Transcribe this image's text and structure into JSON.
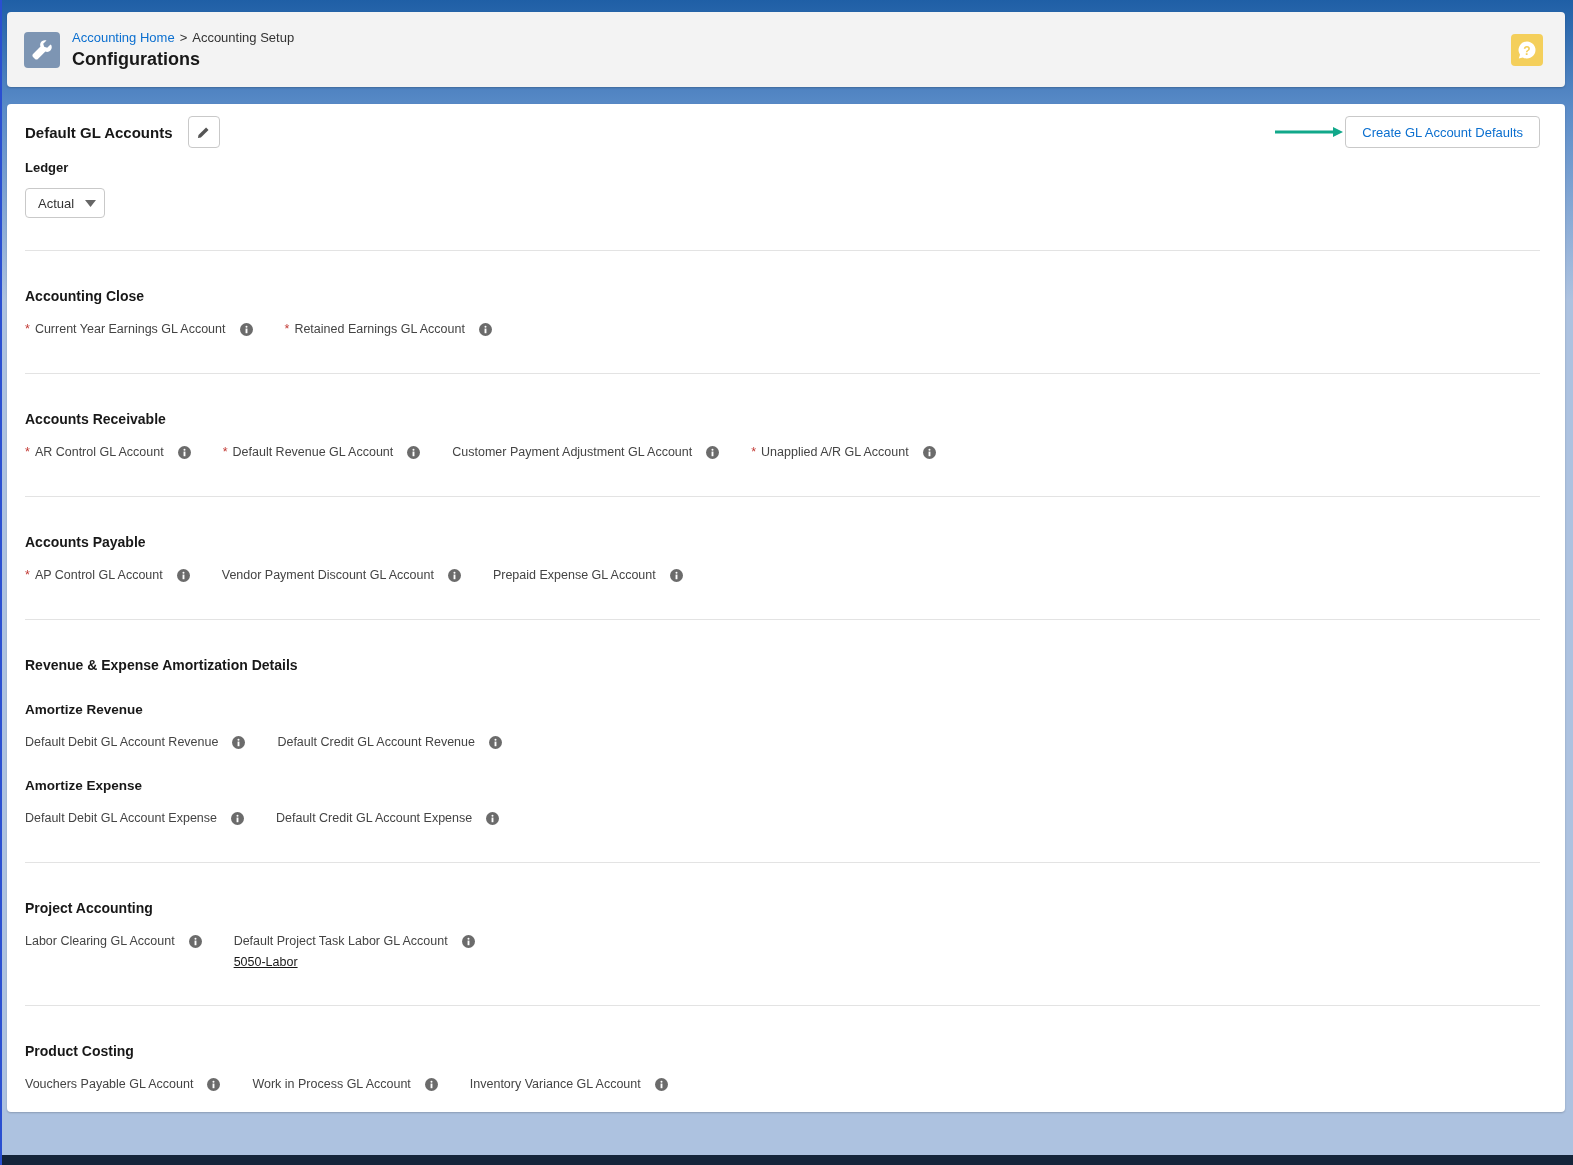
{
  "header": {
    "breadcrumb": [
      {
        "label": "Accounting Home",
        "link": true
      },
      {
        "label": "Accounting Setup",
        "link": false
      }
    ],
    "separator": ">",
    "title": "Configurations",
    "help": "?"
  },
  "required_marker": "*",
  "card": {
    "title": "Default GL Accounts",
    "action_button": "Create GL Account Defaults",
    "ledger": {
      "label": "Ledger",
      "value": "Actual"
    }
  },
  "sections": [
    {
      "title": "Accounting Close",
      "groups": [
        {
          "fields": [
            {
              "label": "Current Year Earnings GL Account",
              "required": true
            },
            {
              "label": "Retained Earnings GL Account",
              "required": true
            }
          ]
        }
      ]
    },
    {
      "title": "Accounts Receivable",
      "groups": [
        {
          "fields": [
            {
              "label": "AR Control GL Account",
              "required": true
            },
            {
              "label": "Default Revenue GL Account",
              "required": true
            },
            {
              "label": "Customer Payment Adjustment GL Account",
              "required": false
            },
            {
              "label": "Unapplied A/R GL Account",
              "required": true
            }
          ]
        }
      ]
    },
    {
      "title": "Accounts Payable",
      "groups": [
        {
          "fields": [
            {
              "label": "AP Control GL Account",
              "required": true
            },
            {
              "label": "Vendor Payment Discount GL Account",
              "required": false
            },
            {
              "label": "Prepaid Expense GL Account",
              "required": false
            }
          ]
        }
      ]
    },
    {
      "title": "Revenue & Expense Amortization Details",
      "groups": [
        {
          "title": "Amortize Revenue",
          "fields": [
            {
              "label": "Default Debit GL Account Revenue",
              "required": false
            },
            {
              "label": "Default Credit GL Account Revenue",
              "required": false
            }
          ]
        },
        {
          "title": "Amortize Expense",
          "fields": [
            {
              "label": "Default Debit GL Account Expense",
              "required": false
            },
            {
              "label": "Default Credit GL Account Expense",
              "required": false
            }
          ]
        }
      ]
    },
    {
      "title": "Project Accounting",
      "groups": [
        {
          "fields": [
            {
              "label": "Labor Clearing GL Account",
              "required": false
            },
            {
              "label": "Default Project Task Labor GL Account",
              "required": false,
              "value": "5050-Labor"
            }
          ]
        }
      ]
    },
    {
      "title": "Product Costing",
      "groups": [
        {
          "fields": [
            {
              "label": "Vouchers Payable GL Account",
              "required": false
            },
            {
              "label": "Work in Process GL Account",
              "required": false
            },
            {
              "label": "Inventory Variance GL Account",
              "required": false
            }
          ]
        }
      ]
    }
  ]
}
